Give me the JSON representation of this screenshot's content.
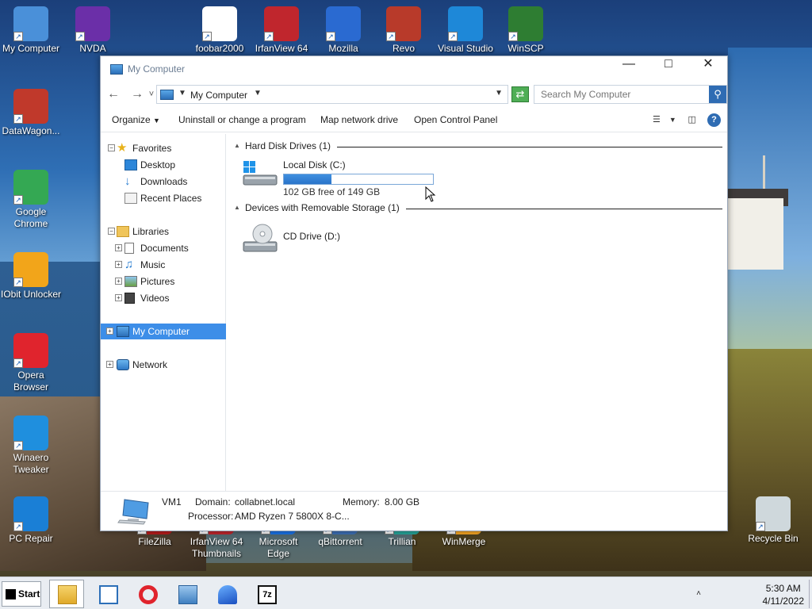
{
  "desktop": {
    "icons": [
      {
        "label": "My Computer",
        "color": "#4a90d9"
      },
      {
        "label": "NVDA",
        "color": "#6b2fa8"
      },
      {
        "label": "foobar2000",
        "color": "#ffffff"
      },
      {
        "label": "IrfanView 64",
        "color": "#c0262d"
      },
      {
        "label": "Mozilla",
        "color": "#2a6ad1"
      },
      {
        "label": "Revo",
        "color": "#b83a2a"
      },
      {
        "label": "Visual Studio",
        "color": "#1e88d8"
      },
      {
        "label": "WinSCP",
        "color": "#2e7d32"
      },
      {
        "label": "DataWagon...",
        "color": "#c0392b"
      },
      {
        "label": "Google Chrome",
        "color": "#34a853"
      },
      {
        "label": "IObit Unlocker",
        "color": "#f2a51a"
      },
      {
        "label": "Opera Browser",
        "color": "#e0242d"
      },
      {
        "label": "Winaero Tweaker",
        "color": "#1f8fde"
      },
      {
        "label": "PC Repair",
        "color": "#1a7fd6"
      },
      {
        "label": "FileZilla",
        "color": "#b71c1c"
      },
      {
        "label": "IrfanView 64 Thumbnails",
        "color": "#c0262d"
      },
      {
        "label": "Microsoft Edge",
        "color": "#1a73e8"
      },
      {
        "label": "qBittorrent",
        "color": "#3d6fb5"
      },
      {
        "label": "Trillian",
        "color": "#26a69a"
      },
      {
        "label": "WinMerge",
        "color": "#f9a825"
      },
      {
        "label": "Recycle Bin",
        "color": "#cfd8dc"
      }
    ]
  },
  "window": {
    "title": "My Computer",
    "minimize": "—",
    "maximize": "□",
    "close": "✕"
  },
  "address": {
    "back": "←",
    "forward": "→",
    "recent": "˅",
    "crumb": "My Computer",
    "search_placeholder": "Search My Computer"
  },
  "toolbar": {
    "organize": "Organize",
    "uninstall": "Uninstall or change a program",
    "map_drive": "Map network drive",
    "control_panel": "Open Control Panel",
    "help": "?"
  },
  "nav": {
    "favorites": "Favorites",
    "desktop": "Desktop",
    "downloads": "Downloads",
    "recent_places": "Recent Places",
    "libraries": "Libraries",
    "documents": "Documents",
    "music": "Music",
    "pictures": "Pictures",
    "videos": "Videos",
    "my_computer": "My Computer",
    "network": "Network"
  },
  "content": {
    "hdd_group": "Hard Disk Drives (1)",
    "removable_group": "Devices with Removable Storage (1)",
    "local_disk": {
      "name": "Local Disk (C:)",
      "free": "102 GB free of 149 GB",
      "used_fraction": 0.32
    },
    "cd_drive": {
      "name": "CD Drive (D:)"
    }
  },
  "details": {
    "name": "VM1",
    "domain_label": "Domain:",
    "domain_value": "collabnet.local",
    "memory_label": "Memory:",
    "memory_value": "8.00 GB",
    "processor_label": "Processor:",
    "processor_value": "AMD Ryzen 7 5800X 8-C..."
  },
  "taskbar": {
    "start": "Start",
    "tray_up": "˄",
    "time": "5:30 AM",
    "date": "4/11/2022"
  }
}
